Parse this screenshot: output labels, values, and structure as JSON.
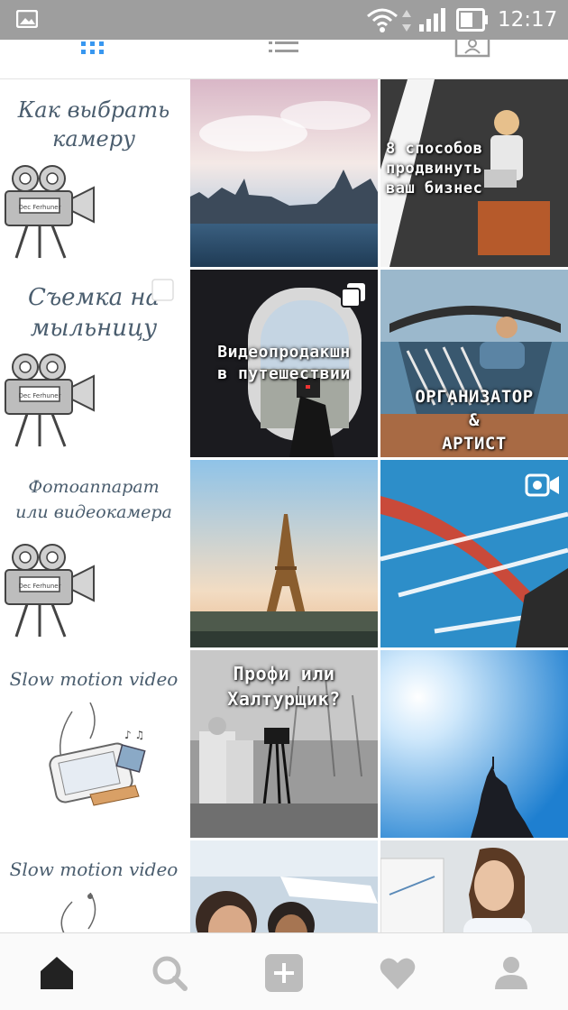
{
  "status_bar": {
    "time": "12:17",
    "icons": [
      "gallery-notification-icon",
      "wifi-icon",
      "data-arrows-icon",
      "cell-signal-icon",
      "battery-icon"
    ]
  },
  "view_tabs": {
    "items": [
      "grid-view-icon",
      "list-view-icon",
      "tagged-photos-icon"
    ],
    "active": "grid-view-icon",
    "accent": "#3897f0"
  },
  "posts": {
    "row1": {
      "left_caption": [
        "Как выбрать",
        "камеру"
      ],
      "camera_label": "Dec Ferhuner",
      "right_caption": [
        "8 способов",
        "продвинуть",
        "ваш бизнес"
      ]
    },
    "row2": {
      "left_caption": [
        "Съемка на",
        "мыльницу"
      ],
      "camera_label": "Dec Ferhuner",
      "middle_caption": [
        "Видеопродакшн",
        "в путешествии"
      ],
      "right_caption": [
        "ОРГАНИЗАТОР",
        "&",
        "АРТИСТ"
      ]
    },
    "row3": {
      "left_caption": [
        "Фотоаппарат",
        "или видеокамера"
      ],
      "camera_label": "Dec Ferhuner"
    },
    "row4": {
      "left_caption": [
        "Slow motion video"
      ],
      "middle_caption": [
        "Профи или",
        "Халтурщик?"
      ]
    },
    "row5": {
      "left_caption": [
        "Slow motion video"
      ]
    }
  },
  "bottom_nav": {
    "items": [
      "home-icon",
      "search-icon",
      "new-post-icon",
      "activity-heart-icon",
      "profile-icon"
    ],
    "active": "home-icon"
  },
  "colors": {
    "status_bar": "#9e9e9e",
    "handwriting": "#4a5d6e",
    "active_icon": "#222222",
    "inactive_icon": "#bcbcbc"
  }
}
